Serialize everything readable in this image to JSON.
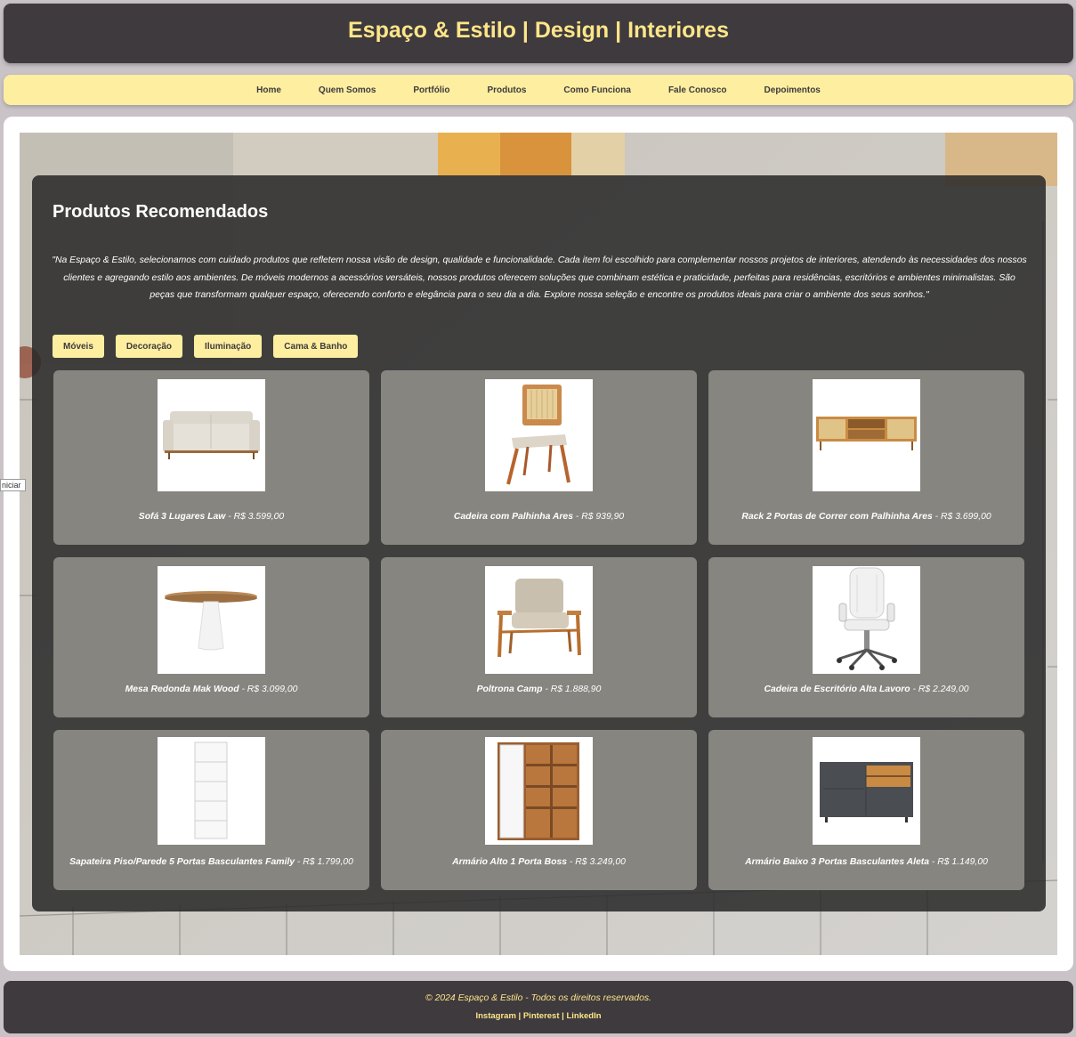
{
  "header": {
    "title": "Espaço & Estilo | Design | Interiores"
  },
  "nav": {
    "items": [
      "Home",
      "Quem Somos",
      "Portfólio",
      "Produtos",
      "Como Funciona",
      "Fale Conosco",
      "Depoimentos"
    ]
  },
  "section": {
    "title": "Produtos Recomendados",
    "intro": "\"Na Espaço & Estilo, selecionamos com cuidado produtos que refletem nossa visão de design, qualidade e funcionalidade. Cada item foi escolhido para complementar nossos projetos de interiores, atendendo às necessidades dos nossos clientes e agregando estilo aos ambientes. De móveis modernos a acessórios versáteis, nossos produtos oferecem soluções que combinam estética e praticidade, perfeitas para residências, escritórios e ambientes minimalistas. São peças que transformam qualquer espaço, oferecendo conforto e elegância para o seu dia a dia. Explore nossa seleção e encontre os produtos ideais para criar o ambiente dos seus sonhos.\""
  },
  "filters": [
    "Móveis",
    "Decoração",
    "Iluminação",
    "Cama & Banho"
  ],
  "products": [
    {
      "name": "Sofá 3 Lugares Law",
      "price": " - R$ 3.599,00",
      "icon": "sofa-icon"
    },
    {
      "name": "Cadeira com Palhinha Ares",
      "price": " - R$ 939,90",
      "icon": "chair-icon"
    },
    {
      "name": "Rack 2 Portas de Correr com Palhinha Ares",
      "price": " - R$ 3.699,00",
      "icon": "rack-icon"
    },
    {
      "name": "Mesa Redonda Mak Wood",
      "price": " - R$ 3.099,00",
      "icon": "table-icon"
    },
    {
      "name": "Poltrona Camp",
      "price": " - R$ 1.888,90",
      "icon": "armchair-icon"
    },
    {
      "name": "Cadeira de Escritório Alta Lavoro",
      "price": " - R$ 2.249,00",
      "icon": "office-chair-icon"
    },
    {
      "name": "Sapateira Piso/Parede 5 Portas Basculantes Family",
      "price": " - R$ 1.799,00",
      "icon": "shoe-cabinet-icon"
    },
    {
      "name": "Armário Alto 1 Porta Boss",
      "price": " - R$ 3.249,00",
      "icon": "tall-cabinet-icon"
    },
    {
      "name": "Armário Baixo 3 Portas Basculantes Aleta",
      "price": " - R$ 1.149,00",
      "icon": "low-cabinet-icon"
    }
  ],
  "footer": {
    "copyright": "© 2024 Espaço & Estilo - Todos os direitos reservados.",
    "links": [
      "Instagram",
      "Pinterest",
      "LinkedIn"
    ]
  },
  "tooltip": "niciar",
  "colors": {
    "dark": "#3f3a3d",
    "accent": "#fde68a",
    "card": "#868580"
  }
}
